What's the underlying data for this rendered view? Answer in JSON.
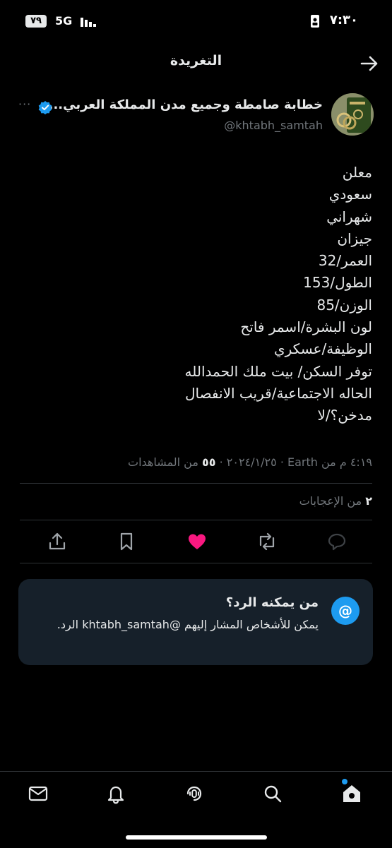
{
  "status_bar": {
    "battery": "٧٩",
    "network": "5G",
    "time": "٧:٣٠"
  },
  "header": {
    "title": "التغريدة"
  },
  "tweet": {
    "author_name": "خطابة صامطة وجميع مدن المملكة العربي...",
    "handle": "@khtabh_samtah",
    "more_label": "···",
    "lines": [
      "معلن",
      "سعودي",
      "شهراني",
      "جيزان",
      "العمر/32",
      "الطول/153",
      "الوزن/85",
      "لون البشرة/اسمر فاتح",
      "الوظيفة/عسكري",
      "توفر السكن/ بيت ملك الحمدالله",
      "الحاله الاجتماعية/قريب الانفصال",
      "مدخن؟/لا"
    ],
    "timestamp": "٤:١٩ م من Earth · ٢٠٢٤/١/٢٥",
    "views_count": "٥٥",
    "views_label": "من المشاهدات",
    "likes_count": "٢",
    "likes_label": "من الإعجابات"
  },
  "reply_card": {
    "icon": "@",
    "title": "من يمكنه الرد؟",
    "text": "يمكن للأشخاص المشار إليهم @khtabh_samtah الرد."
  },
  "colors": {
    "accent": "#1d9bf0",
    "like": "#f91880",
    "card_bg": "#16202a"
  }
}
